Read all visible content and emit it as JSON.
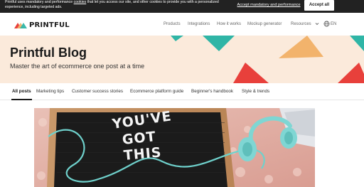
{
  "cookie_bar": {
    "text_before": "Printful uses mandatory and performance",
    "link": "cookies",
    "text_after": "that let you access our site, and other cookies to provide you with a personalized experience, including targeted ads.",
    "mandatory_button": "Accept mandatory and performance",
    "accept_button": "Accept all"
  },
  "header": {
    "logo_text": "PRINTFUL",
    "nav": [
      "Products",
      "Integrations",
      "How it works",
      "Mockup generator",
      "Resources"
    ],
    "language": "EN"
  },
  "hero": {
    "title": "Printful Blog",
    "subtitle": "Master the art of ecommerce one post at a time"
  },
  "tabs": [
    "All posts",
    "Marketing tips",
    "Customer success stories",
    "Ecommerce platform guide",
    "Beginner's handbook",
    "Style & trends"
  ],
  "feature": {
    "board_text": [
      "YOU'VE",
      "GOT",
      "THIS"
    ]
  },
  "colors": {
    "cookie_bg": "#222222",
    "hero_bg": "#fbeadb",
    "triangle_teal": "#2fb5a6",
    "triangle_red": "#e8403b",
    "triangle_orange": "#f2b36c",
    "headphones": "#7fd6d3"
  }
}
